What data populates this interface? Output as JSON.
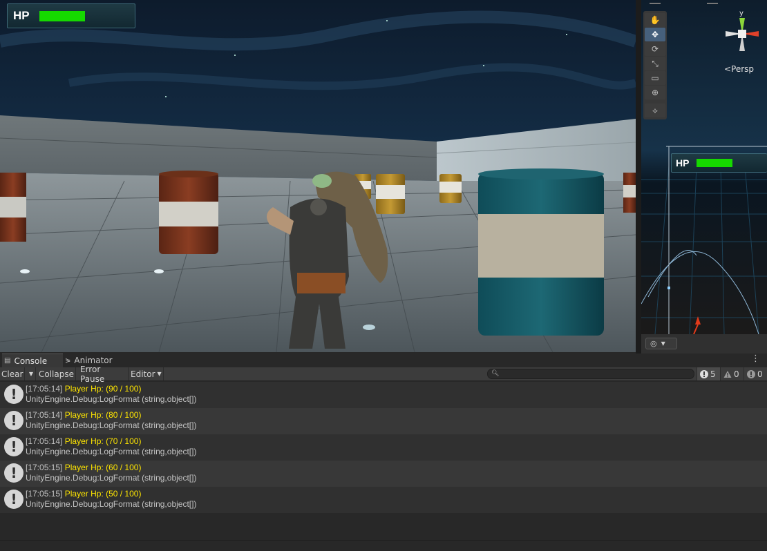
{
  "game_view": {
    "hud": {
      "hp_label": "HP",
      "hp_fraction": 1.0,
      "hp_color": "#16d900"
    }
  },
  "scene_view": {
    "tools": [
      {
        "name": "hand-tool",
        "glyph": "✋"
      },
      {
        "name": "move-tool",
        "glyph": "✥",
        "active": true
      },
      {
        "name": "rotate-tool",
        "glyph": "⟳"
      },
      {
        "name": "scale-tool",
        "glyph": "⤡"
      },
      {
        "name": "rect-tool",
        "glyph": "▭"
      },
      {
        "name": "transform-tool",
        "glyph": "⊕"
      },
      {
        "name": "custom-tool",
        "glyph": "⟡"
      }
    ],
    "gizmo_axis_label": "y",
    "projection_label": "<Persp",
    "hud": {
      "hp_label": "HP",
      "hp_fraction": 1.0
    }
  },
  "console": {
    "tabs": {
      "console": "Console",
      "animator": "Animator"
    },
    "toolbar": {
      "clear": "Clear",
      "collapse": "Collapse",
      "error_pause": "Error Pause",
      "editor": "Editor",
      "search_placeholder": ""
    },
    "counts": {
      "log": "5",
      "warning": "0",
      "error": "0"
    },
    "entries": [
      {
        "time": "[17:05:14]",
        "message": "Player Hp: (90 / 100)",
        "trace": "UnityEngine.Debug:LogFormat (string,object[])"
      },
      {
        "time": "[17:05:14]",
        "message": "Player Hp: (80 / 100)",
        "trace": "UnityEngine.Debug:LogFormat (string,object[])"
      },
      {
        "time": "[17:05:14]",
        "message": "Player Hp: (70 / 100)",
        "trace": "UnityEngine.Debug:LogFormat (string,object[])"
      },
      {
        "time": "[17:05:15]",
        "message": "Player Hp: (60 / 100)",
        "trace": "UnityEngine.Debug:LogFormat (string,object[])"
      },
      {
        "time": "[17:05:15]",
        "message": "Player Hp: (50 / 100)",
        "trace": "UnityEngine.Debug:LogFormat (string,object[])"
      }
    ],
    "colors": {
      "message": "#ffe600",
      "text": "#c4c4c4"
    }
  }
}
